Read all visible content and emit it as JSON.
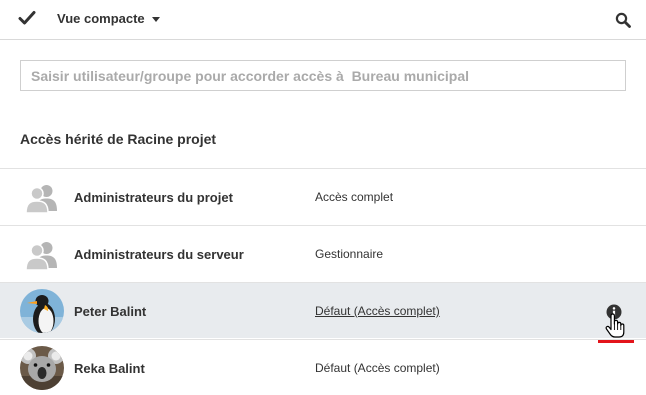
{
  "toolbar": {
    "view_label": "Vue compacte",
    "icons": {
      "check": "checkmark-icon",
      "search": "search-icon"
    }
  },
  "share": {
    "placeholder": "Saisir utilisateur/groupe pour accorder accès à  Bureau municipal"
  },
  "section": {
    "title": "Accès hérité de Racine projet"
  },
  "rows": [
    {
      "name": "Administrateurs du projet",
      "access": "Accès complet",
      "avatar": "group-icon",
      "highlighted": false
    },
    {
      "name": "Administrateurs du serveur",
      "access": "Gestionnaire",
      "avatar": "group-icon",
      "highlighted": false
    },
    {
      "name": "Peter Balint",
      "access": "Défaut  (Accès complet)",
      "avatar": "penguin-avatar",
      "highlighted": true,
      "info_icon": "info-icon"
    },
    {
      "name": "Reka Balint",
      "access": "Défaut  (Accès complet)",
      "avatar": "koala-avatar",
      "highlighted": false
    }
  ],
  "colors": {
    "highlight_row": "#e8ebee",
    "annotation_underline": "#e3141b"
  }
}
